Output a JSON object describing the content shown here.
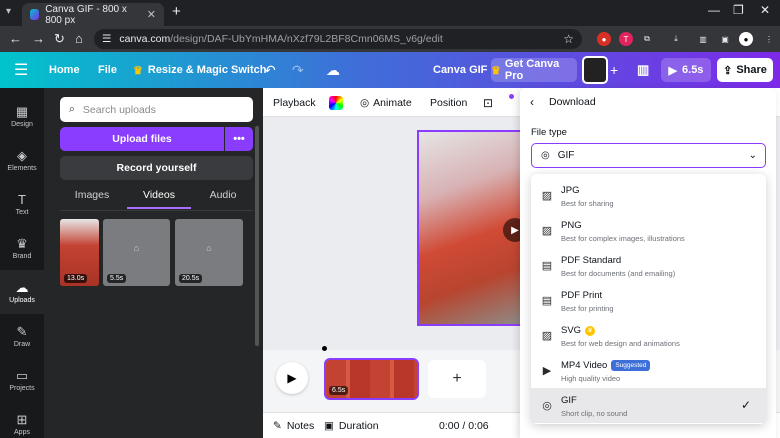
{
  "browser": {
    "tab_title": "Canva GIF - 800 x 800 px",
    "url_main": "canva.com",
    "url_path": "/design/DAF-UbYmHMA/nXzf79L2BF8Cmn06MS_v6g/edit"
  },
  "header": {
    "home": "Home",
    "file": "File",
    "resize": "Resize & Magic Switch",
    "doc_title": "Canva GIF",
    "get_pro": "Get Canva Pro",
    "duration": "6.5s",
    "share": "Share"
  },
  "rail": [
    {
      "label": "Design",
      "icon": "design-icon"
    },
    {
      "label": "Elements",
      "icon": "elements-icon"
    },
    {
      "label": "Text",
      "icon": "text-icon"
    },
    {
      "label": "Brand",
      "icon": "brand-icon"
    },
    {
      "label": "Uploads",
      "icon": "uploads-icon"
    },
    {
      "label": "Draw",
      "icon": "draw-icon"
    },
    {
      "label": "Projects",
      "icon": "projects-icon"
    },
    {
      "label": "Apps",
      "icon": "apps-icon"
    }
  ],
  "panel": {
    "search_placeholder": "Search uploads",
    "upload_files": "Upload files",
    "more": "•••",
    "record": "Record yourself",
    "tabs": [
      "Images",
      "Videos",
      "Audio"
    ],
    "thumbs": [
      {
        "duration": "13.0s"
      },
      {
        "duration": "5.5s"
      },
      {
        "duration": "20.5s"
      }
    ]
  },
  "toolbar": {
    "playback": "Playback",
    "animate": "Animate",
    "position": "Position"
  },
  "timeline": {
    "clip_duration": "6.5s"
  },
  "footer": {
    "notes": "Notes",
    "duration": "Duration",
    "time": "0:00 / 0:06"
  },
  "download": {
    "title": "Download",
    "file_type_label": "File type",
    "selected": "GIF",
    "options": [
      {
        "name": "JPG",
        "desc": "Best for sharing",
        "icon": "image-icon"
      },
      {
        "name": "PNG",
        "desc": "Best for complex images, illustrations",
        "icon": "image-icon"
      },
      {
        "name": "PDF Standard",
        "desc": "Best for documents (and emailing)",
        "icon": "document-icon"
      },
      {
        "name": "PDF Print",
        "desc": "Best for printing",
        "icon": "document-icon"
      },
      {
        "name": "SVG",
        "desc": "Best for web design and animations",
        "icon": "image-icon",
        "pro": true
      },
      {
        "name": "MP4 Video",
        "desc": "High quality video",
        "icon": "video-icon",
        "badge": "Suggested"
      },
      {
        "name": "GIF",
        "desc": "Short clip, no sound",
        "icon": "gif-icon",
        "selected": true
      }
    ]
  },
  "colors": {
    "accent": "#8b3dff",
    "header_start": "#00c4cc",
    "header_end": "#7d2ae8"
  }
}
